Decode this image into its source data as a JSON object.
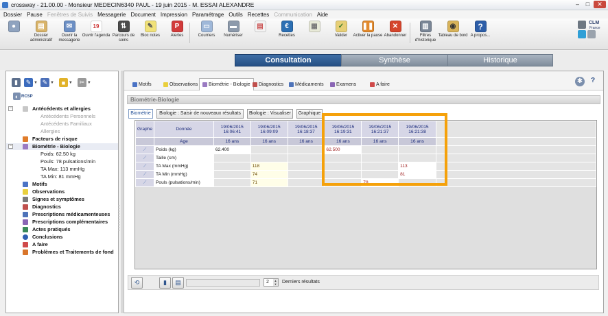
{
  "window": {
    "title": "crossway - 21.00.00 - Monsieur MEDECIN6340 PAUL - 19 juin 2015 - M. ESSAI ALEXANDRE"
  },
  "menu": [
    {
      "label": "Dossier",
      "disabled": false
    },
    {
      "label": "Pause",
      "disabled": false
    },
    {
      "label": "Fenêtres de Suivis",
      "disabled": true
    },
    {
      "label": "Messagerie",
      "disabled": false
    },
    {
      "label": "Document",
      "disabled": false
    },
    {
      "label": "Impression",
      "disabled": false
    },
    {
      "label": "Paramétrage",
      "disabled": false
    },
    {
      "label": "Outils",
      "disabled": false
    },
    {
      "label": "Recettes",
      "disabled": false
    },
    {
      "label": "Communication",
      "disabled": true
    },
    {
      "label": "Aide",
      "disabled": false
    }
  ],
  "toolbar": {
    "dossier": "Dossier administratif",
    "messagerie": "Ouvrir la messagerie",
    "agenda": "Ouvrir l'agenda",
    "agenda_day": "19",
    "parcours": "Parcours de soins",
    "bloc": "Bloc notes",
    "alertes": "Alertes",
    "courriers": "Courriers",
    "numeriser": "Numériser",
    "recettes": "Recettes",
    "valider": "Valider",
    "activer": "Activer la pause",
    "abandonner": "Abandonner",
    "filtres": "Filtres d'historique",
    "tableau": "Tableau de bord",
    "apropos": "A propos..."
  },
  "brand": {
    "name": "CLM",
    "sub": "France"
  },
  "main_tabs": {
    "consultation": "Consultation",
    "synthese": "Synthèse",
    "historique": "Historique"
  },
  "left": {
    "rcsp": "RCSP",
    "tree": {
      "antecedents": "Antécédents et allergies",
      "ant_perso": "Antécédents Personnels",
      "ant_fam": "Antécédents Familiaux",
      "allergies": "Allergies",
      "facteurs": "Facteurs de risque",
      "biometrie": "Biométrie - Biologie",
      "poids": "Poids: 62.50 kg",
      "pouls": "Pouls: 78 pulsations/min",
      "tamax": "TA Max: 113 mmHg",
      "tamin": "TA Min: 81 mmHg",
      "motifs": "Motifs",
      "observations": "Observations",
      "signes": "Signes et symptômes",
      "diagnostics": "Diagnostics",
      "presc_med": "Prescriptions médicamenteuses",
      "presc_comp": "Prescriptions complémentaires",
      "actes": "Actes pratiqués",
      "conclusions": "Conclusions",
      "afaire": "A faire",
      "problemes": "Problèmes et Traitements de fond"
    }
  },
  "subtabs": {
    "motifs": "Motifs",
    "observations": "Observations",
    "biometrie": "Biométrie - Biologie",
    "diagnostics": "Diagnostics",
    "medicaments": "Médicaments",
    "examens": "Examens",
    "afaire": "A faire"
  },
  "section_title": "Biométrie-Biologie",
  "buttons": {
    "biometrie": "Biométrie",
    "saisie": "Biologie : Saisir de nouveaux résultats",
    "visualiser": "Biologie : Visualiser",
    "graphique": "Graphique"
  },
  "grid": {
    "h_graphe": "Graphe",
    "h_donnee": "Donnée",
    "age_label": "Age",
    "dates": [
      {
        "d": "19/06/2015",
        "t": "16:06:41",
        "age": "16 ans"
      },
      {
        "d": "19/06/2015",
        "t": "16:09:09",
        "age": "16 ans"
      },
      {
        "d": "19/06/2015",
        "t": "16:18:37",
        "age": "16 ans"
      },
      {
        "d": "19/06/2015",
        "t": "16:19:31",
        "age": "16 ans"
      },
      {
        "d": "19/06/2015",
        "t": "16:21:37",
        "age": "16 ans"
      },
      {
        "d": "19/06/2015",
        "t": "16:21:38",
        "age": "16 ans"
      }
    ],
    "rows": [
      {
        "name": "Poids (kg)",
        "cells": [
          "62.400",
          "",
          "",
          "62.500",
          "",
          ""
        ]
      },
      {
        "name": "Taille (cm)",
        "cells": [
          "",
          "",
          "",
          "",
          "",
          ""
        ]
      },
      {
        "name": "TA Max (mmHg)",
        "cells": [
          "",
          "118",
          "",
          "",
          "",
          "113"
        ]
      },
      {
        "name": "TA Min (mmHg)",
        "cells": [
          "",
          "74",
          "",
          "",
          "",
          "81"
        ]
      },
      {
        "name": "Pouls (pulsations/min)",
        "cells": [
          "",
          "71",
          "",
          "",
          "78",
          ""
        ]
      }
    ]
  },
  "bottom": {
    "count": "2",
    "label": "Derniers résultats"
  }
}
